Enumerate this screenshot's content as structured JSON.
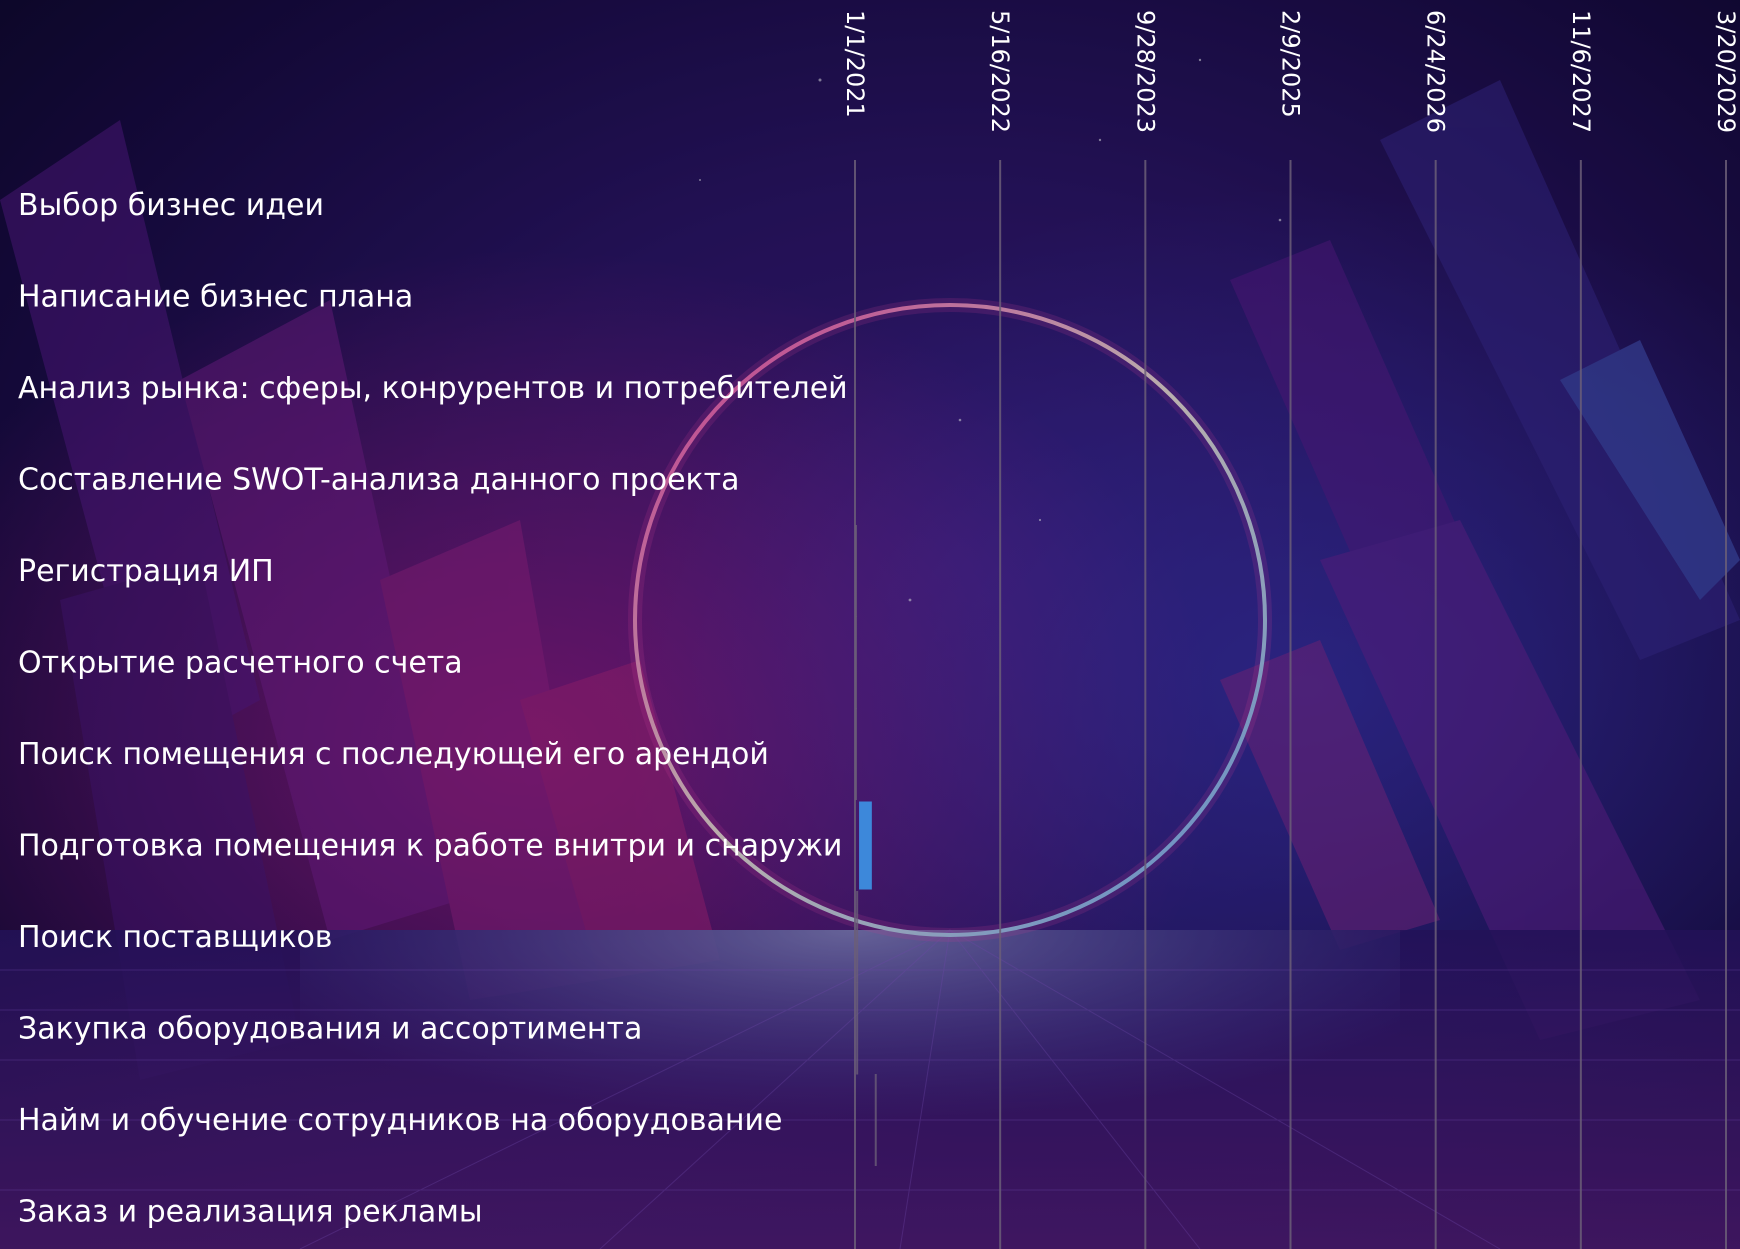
{
  "chart_data": {
    "type": "gantt",
    "title": "",
    "xlabel": "",
    "ylabel": "",
    "x_axis": {
      "kind": "date",
      "range": [
        "2021-01-01",
        "2029-03-20"
      ],
      "ticks": [
        {
          "date": "2021-01-01",
          "label": "1/1/2021"
        },
        {
          "date": "2022-05-16",
          "label": "5/16/2022"
        },
        {
          "date": "2023-09-28",
          "label": "9/28/2023"
        },
        {
          "date": "2025-02-09",
          "label": "2/9/2025"
        },
        {
          "date": "2026-06-24",
          "label": "6/24/2026"
        },
        {
          "date": "2027-11-06",
          "label": "11/6/2027"
        },
        {
          "date": "2029-03-20",
          "label": "3/20/2029"
        }
      ],
      "tick_label_orientation": "vertical",
      "grid": true
    },
    "tasks": [
      {
        "name": "Выбор бизнес идеи",
        "start": null,
        "end": null
      },
      {
        "name": "Написание бизнес плана",
        "start": null,
        "end": null
      },
      {
        "name": "Анализ рынка: сферы, конрурентов и потребителей",
        "start": null,
        "end": null
      },
      {
        "name": "Составление SWOT-анализа данного проекта",
        "start": null,
        "end": null
      },
      {
        "name": "Регистрация ИП",
        "start": "2021-01-01",
        "end": "2021-01-03"
      },
      {
        "name": "Открытие расчетного счета",
        "start": "2021-01-01",
        "end": "2021-01-03"
      },
      {
        "name": "Поиск помещения с последующей его арендой",
        "start": "2021-01-01",
        "end": "2021-01-03"
      },
      {
        "name": "Подготовка помещения к работе внитри и снаружи",
        "start": "2021-01-15",
        "end": "2021-02-28"
      },
      {
        "name": "Поиск поставщиков",
        "start": "2021-01-05",
        "end": "2021-01-07"
      },
      {
        "name": "Закупка оборудования и ассортимента",
        "start": "2021-01-05",
        "end": "2021-01-07"
      },
      {
        "name": "Найм и обучение сотрудников на оборудование",
        "start": "2021-03-10",
        "end": "2021-03-12"
      },
      {
        "name": "Заказ и реализация рекламы",
        "start": null,
        "end": null
      }
    ],
    "bar_colors": {
      "main": "#3d8ee0",
      "thin": "#6b5e78"
    }
  }
}
